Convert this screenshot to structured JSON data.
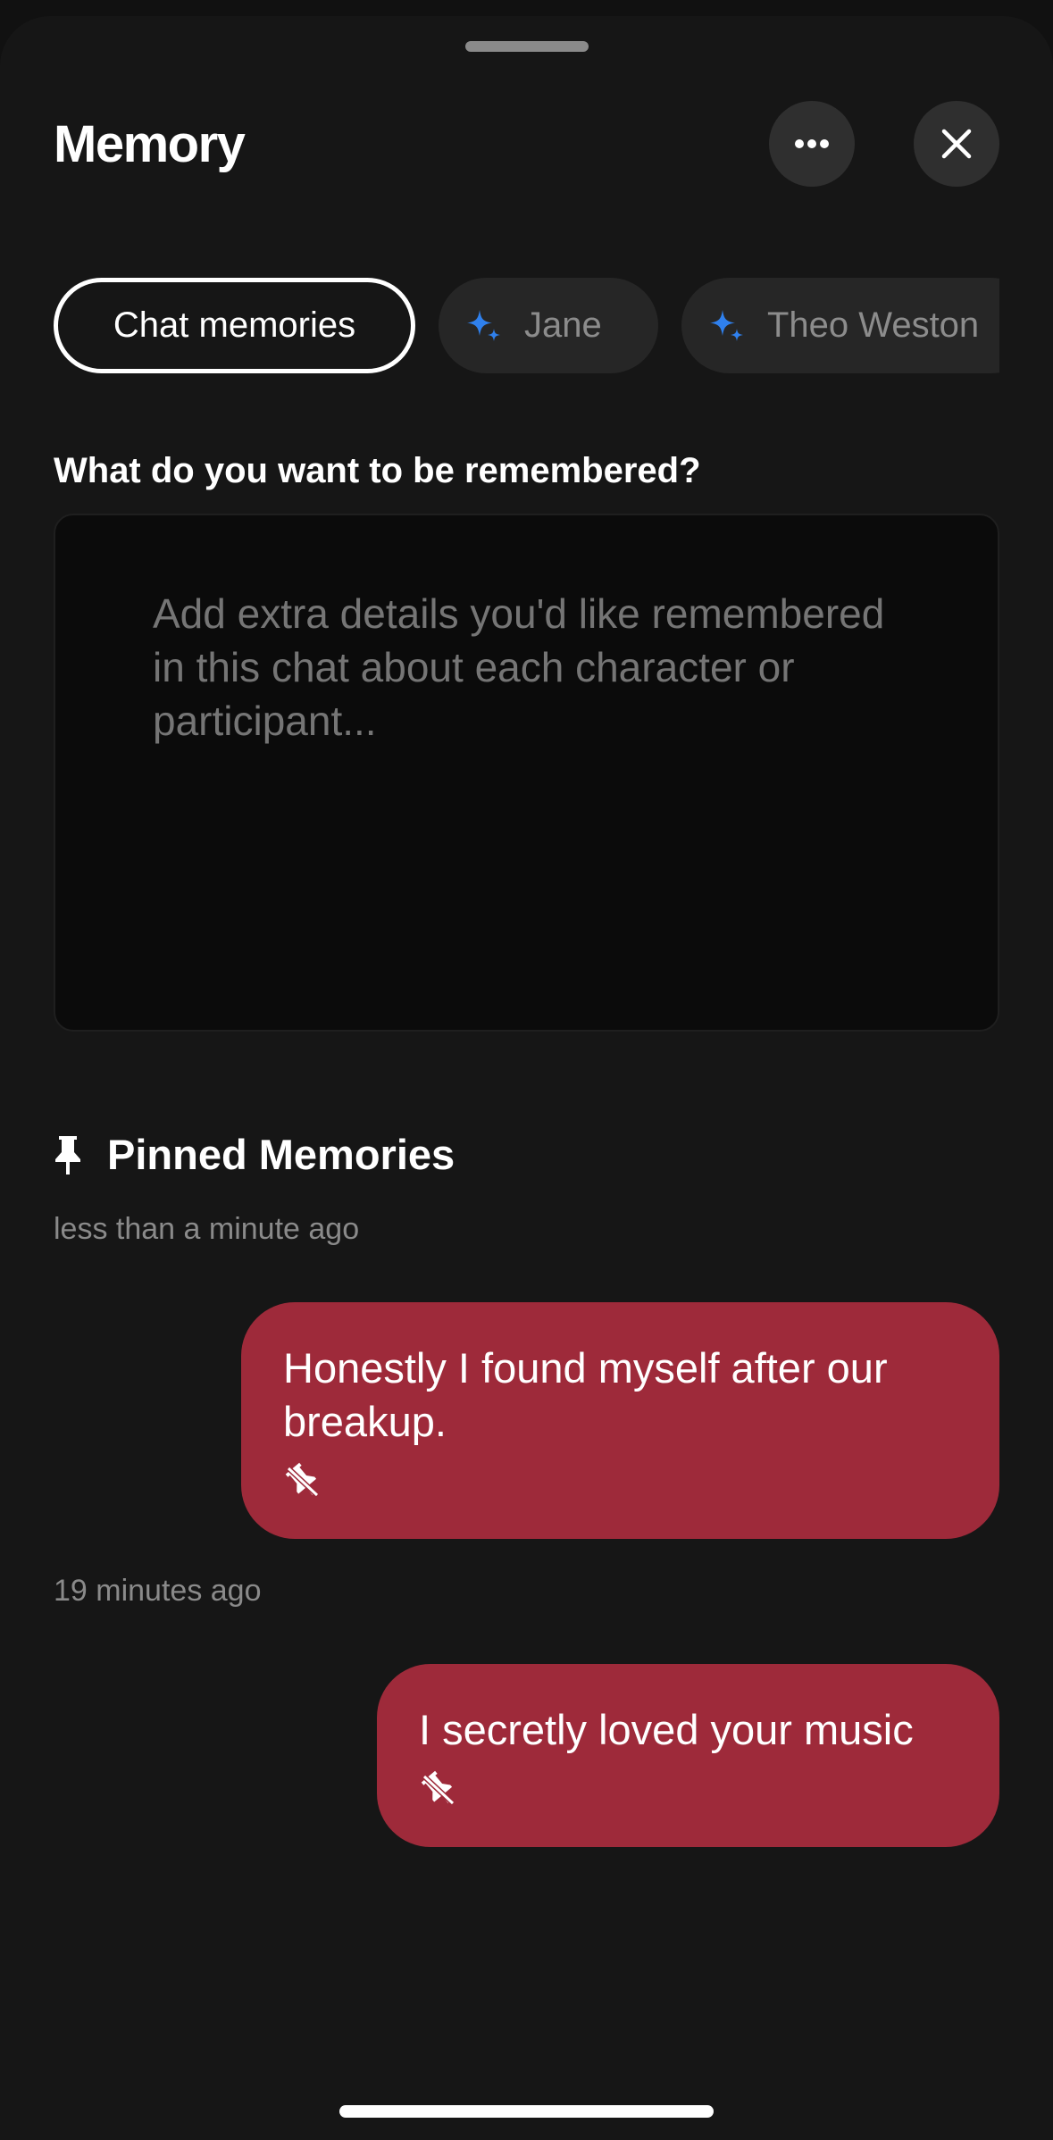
{
  "header": {
    "title": "Memory",
    "more_icon": "ellipsis-icon",
    "close_icon": "close-icon"
  },
  "tabs": [
    {
      "label": "Chat memories",
      "active": true
    },
    {
      "label": "Jane",
      "icon": "sparkle-icon",
      "active": false
    },
    {
      "label": "Theo Weston",
      "icon": "sparkle-icon",
      "active": false
    }
  ],
  "memory_input": {
    "label": "What do you want to be remembered?",
    "value": "",
    "placeholder": "Add extra details you'd like remembered in this chat about each character or participant..."
  },
  "pinned": {
    "title": "Pinned Memories",
    "icon": "pin-icon",
    "items": [
      {
        "time": "less than a minute ago",
        "text": "Honestly I found myself after our breakup.",
        "action_icon": "unpin-icon"
      },
      {
        "time": "19 minutes ago",
        "text": "I secretly loved your music",
        "action_icon": "unpin-icon"
      }
    ]
  },
  "colors": {
    "background": "#161616",
    "bubble": "#9e2a3a",
    "sparkle_accent": "#2f80ed"
  }
}
